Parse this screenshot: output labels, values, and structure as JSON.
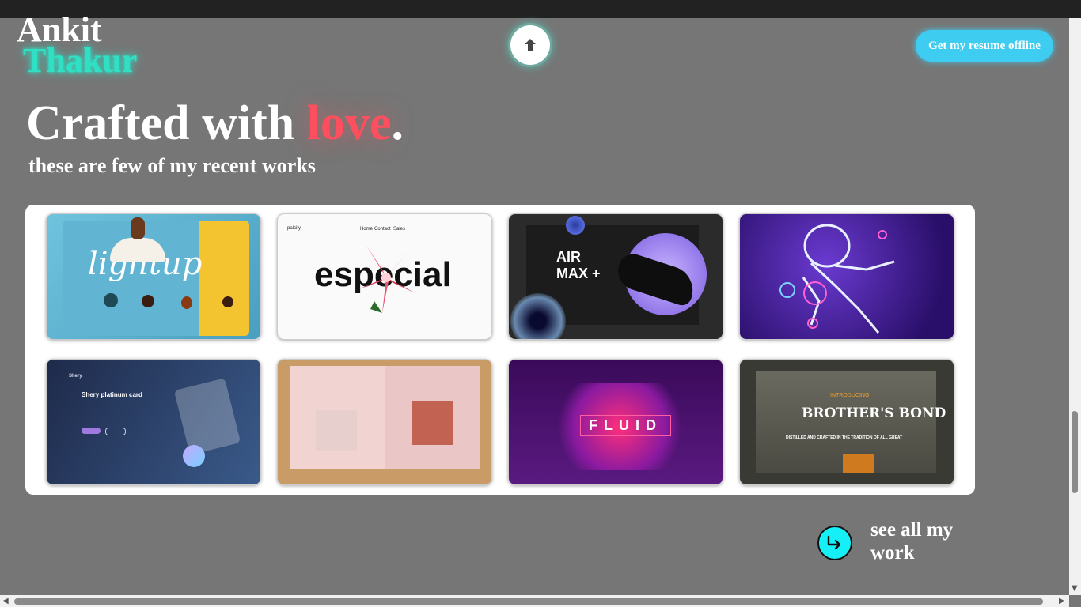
{
  "header": {
    "logo_first": "Ankit",
    "logo_last": "Thakur",
    "scroll_up_icon": "arrow-up-icon",
    "resume_button": "Get my resume offline"
  },
  "hero": {
    "headline_start": "Crafted with ",
    "headline_accent": "love",
    "headline_end": ".",
    "subheading": "these are few of my recent works"
  },
  "works": [
    {
      "id": "lightup",
      "title": "lightup",
      "theme": "#5fb7d4"
    },
    {
      "id": "especial",
      "title": "especial",
      "nav": [
        "Home",
        "Contact",
        "Sales"
      ],
      "brand": "palcify",
      "theme": "#ffffff"
    },
    {
      "id": "airmax",
      "title": "AIR MAX +",
      "theme": "#2a2a2a"
    },
    {
      "id": "astronaut",
      "title": "",
      "theme": "#3a1a8a"
    },
    {
      "id": "shery",
      "title": "Shery platinum card",
      "brand": "Shery",
      "theme": "#2a3d64"
    },
    {
      "id": "portfolio",
      "title": "",
      "theme": "#c9a071"
    },
    {
      "id": "fluid",
      "title": "FLUID",
      "theme": "#4a1670"
    },
    {
      "id": "brothers-bond",
      "title": "BROTHER'S BOND",
      "tagline": "DISTILLED AND CRAFTED IN THE TRADITION OF ALL GREAT",
      "intro": "INTRODUCING",
      "theme": "#3a3a35"
    }
  ],
  "see_all": {
    "icon": "arrow-right-circle-icon",
    "label": "see all my work"
  },
  "colors": {
    "accent_teal": "#2fe0c4",
    "accent_love": "#ff4f5f",
    "resume_button": "#3ecdf0",
    "see_all_button": "#14f0f6"
  }
}
